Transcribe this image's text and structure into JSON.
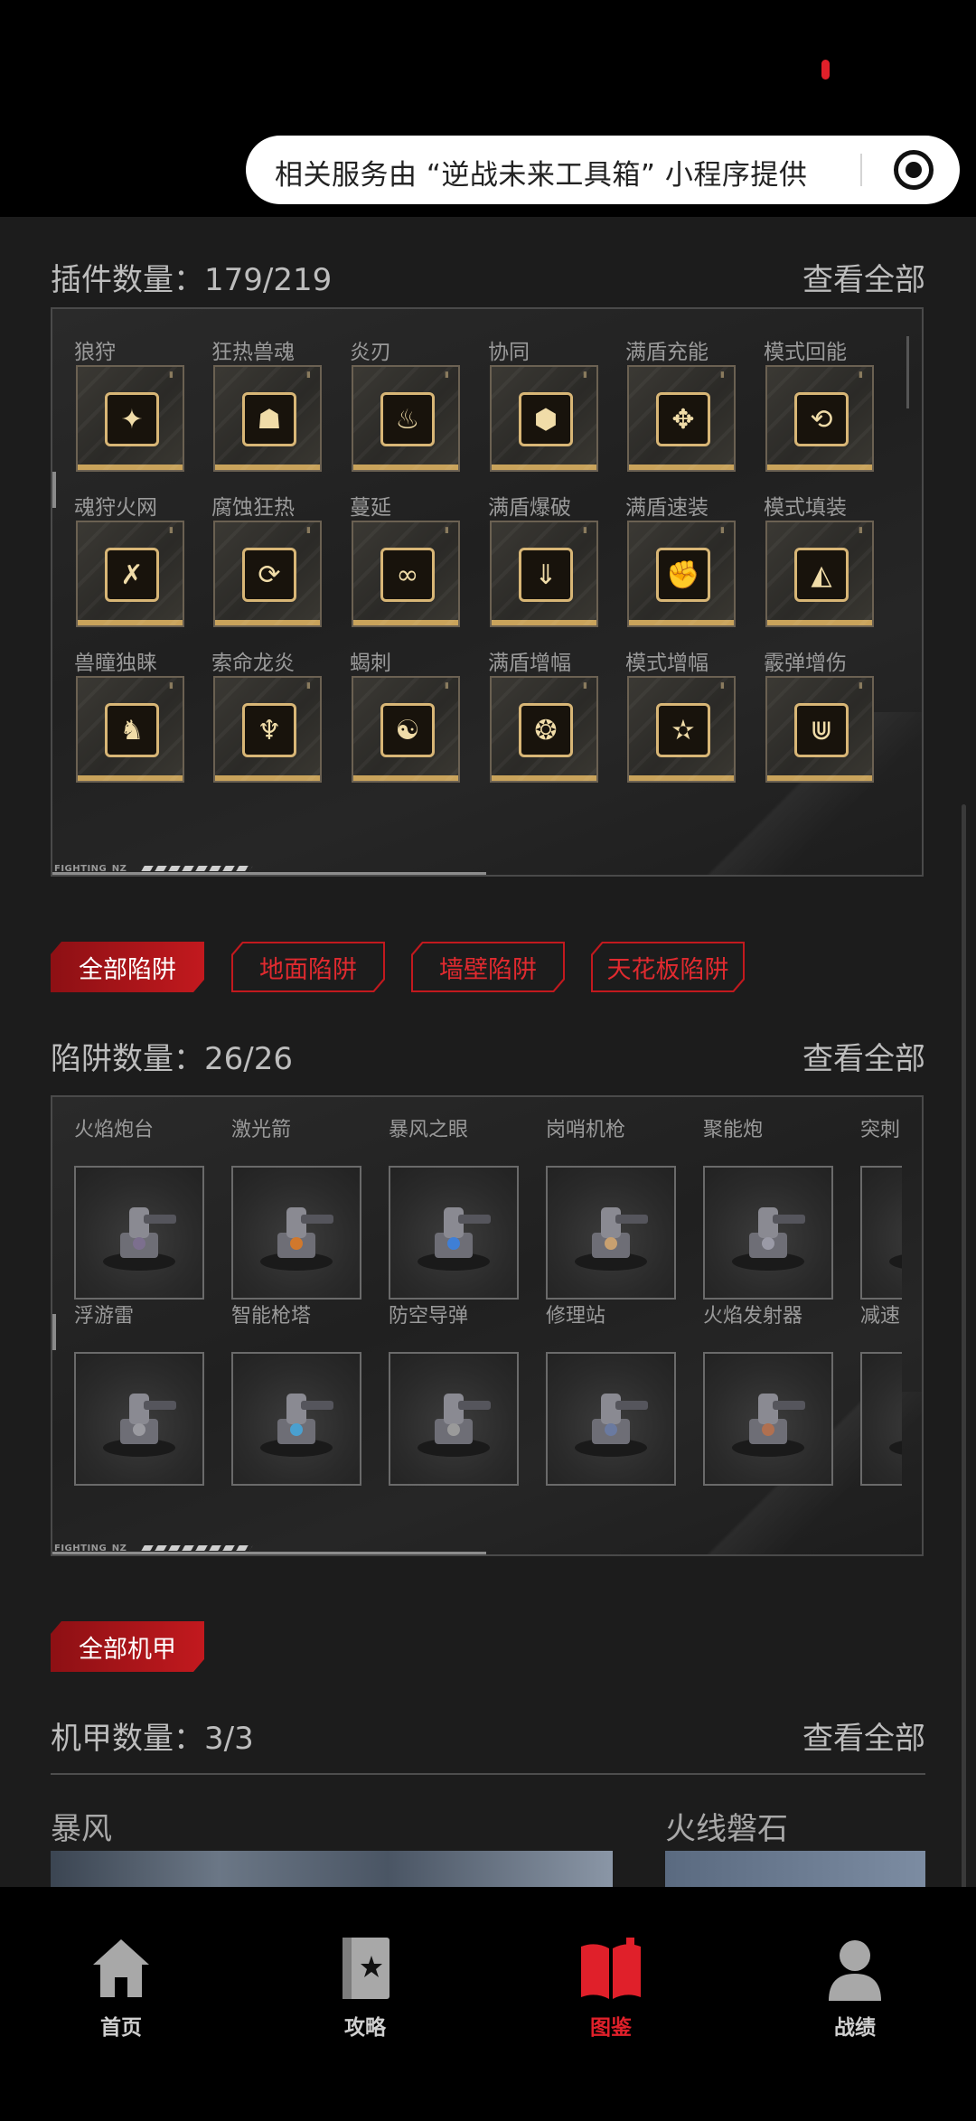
{
  "banner": {
    "service_text": "相关服务由 “逆战未来工具箱” 小程序提供"
  },
  "plugins": {
    "title": "插件数量：179/219",
    "view_all": "查看全部",
    "items": [
      {
        "label": "狼狩",
        "glyph": "✦"
      },
      {
        "label": "狂热兽魂",
        "glyph": "☗"
      },
      {
        "label": "炎刃",
        "glyph": "♨"
      },
      {
        "label": "协同",
        "glyph": "⬢"
      },
      {
        "label": "满盾充能",
        "glyph": "✥"
      },
      {
        "label": "模式回能",
        "glyph": "⟲"
      },
      {
        "label": "魂狩火网",
        "glyph": "✗"
      },
      {
        "label": "腐蚀狂热",
        "glyph": "⟳"
      },
      {
        "label": "蔓延",
        "glyph": "∞"
      },
      {
        "label": "满盾爆破",
        "glyph": "⇓"
      },
      {
        "label": "满盾速装",
        "glyph": "✊"
      },
      {
        "label": "模式填装",
        "glyph": "◭"
      },
      {
        "label": "兽瞳独睐",
        "glyph": "♞"
      },
      {
        "label": "索命龙炎",
        "glyph": "♆"
      },
      {
        "label": "蝎刺",
        "glyph": "☯"
      },
      {
        "label": "满盾增幅",
        "glyph": "❂"
      },
      {
        "label": "模式增幅",
        "glyph": "✫"
      },
      {
        "label": "霰弹增伤",
        "glyph": "⋓"
      }
    ],
    "footer_text": "FIGHTING_NZ"
  },
  "trap_filters": {
    "tabs": [
      {
        "label": "全部陷阱",
        "active": true
      },
      {
        "label": "地面陷阱",
        "active": false
      },
      {
        "label": "墙壁陷阱",
        "active": false
      },
      {
        "label": "天花板陷阱",
        "active": false
      }
    ]
  },
  "traps": {
    "title": "陷阱数量：26/26",
    "view_all": "查看全部",
    "items": [
      {
        "label": "火焰炮台"
      },
      {
        "label": "激光箭"
      },
      {
        "label": "暴风之眼"
      },
      {
        "label": "岗哨机枪"
      },
      {
        "label": "聚能炮"
      },
      {
        "label": "突刺"
      },
      {
        "label": "浮游雷"
      },
      {
        "label": "智能枪塔"
      },
      {
        "label": "防空导弹"
      },
      {
        "label": "修理站"
      },
      {
        "label": "火焰发射器"
      },
      {
        "label": "减速"
      }
    ],
    "footer_text": "FIGHTING_NZ"
  },
  "mech_filter": {
    "label": "全部机甲"
  },
  "mechs": {
    "title": "机甲数量：3/3",
    "view_all": "查看全部",
    "items": [
      {
        "name": "暴风"
      },
      {
        "name": "火线磐石"
      }
    ]
  },
  "nav": {
    "items": [
      {
        "label": "首页",
        "icon": "home-icon",
        "active": false
      },
      {
        "label": "攻略",
        "icon": "guide-icon",
        "active": false
      },
      {
        "label": "图鉴",
        "icon": "book-icon",
        "active": true
      },
      {
        "label": "战绩",
        "icon": "profile-icon",
        "active": false
      }
    ]
  },
  "colors": {
    "accent_red": "#e0202a",
    "gold": "#d8b676",
    "background": "#1c1c1c"
  }
}
